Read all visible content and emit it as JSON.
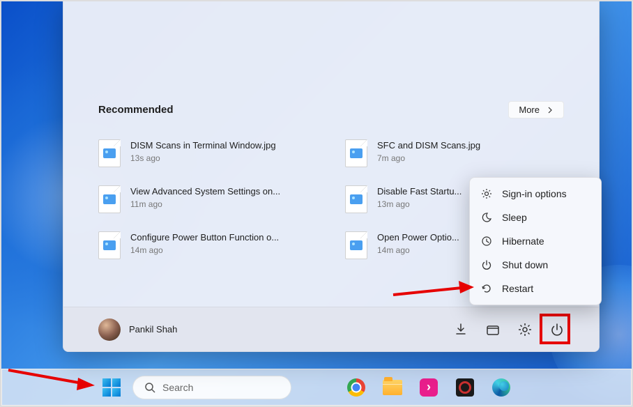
{
  "recommended": {
    "title": "Recommended",
    "more_label": "More",
    "items": [
      {
        "name": "DISM Scans in Terminal Window.jpg",
        "time": "13s ago"
      },
      {
        "name": "SFC and DISM Scans.jpg",
        "time": "7m ago"
      },
      {
        "name": "View Advanced System Settings on...",
        "time": "11m ago"
      },
      {
        "name": "Disable Fast Startu...",
        "time": "13m ago"
      },
      {
        "name": "Configure Power Button Function o...",
        "time": "14m ago"
      },
      {
        "name": "Open Power Optio...",
        "time": "14m ago"
      }
    ]
  },
  "user": {
    "name": "Pankil Shah"
  },
  "power_menu": {
    "items": [
      {
        "label": "Sign-in options",
        "icon": "gear-icon"
      },
      {
        "label": "Sleep",
        "icon": "moon-icon"
      },
      {
        "label": "Hibernate",
        "icon": "clock-icon"
      },
      {
        "label": "Shut down",
        "icon": "power-icon"
      },
      {
        "label": "Restart",
        "icon": "restart-icon"
      }
    ]
  },
  "taskbar": {
    "search_placeholder": "Search"
  }
}
